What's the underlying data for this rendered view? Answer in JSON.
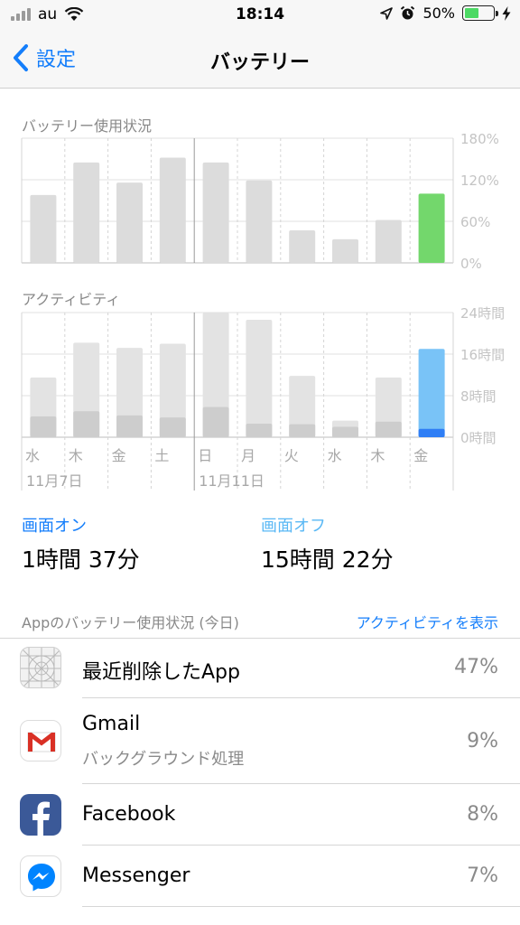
{
  "status_bar": {
    "carrier": "au",
    "time": "18:14",
    "battery_percent": "50%",
    "battery_level": 0.5
  },
  "nav": {
    "back_label": "設定",
    "title": "バッテリー"
  },
  "battery_chart": {
    "label": "バッテリー使用状況",
    "ticks": [
      "180%",
      "120%",
      "60%",
      "0%"
    ]
  },
  "activity_chart": {
    "label": "アクティビティ",
    "ticks": [
      "24時間",
      "16時間",
      "8時間",
      "0時間"
    ]
  },
  "days": [
    "水",
    "木",
    "金",
    "土",
    "日",
    "月",
    "火",
    "水",
    "木",
    "金"
  ],
  "dates": [
    "11月7日",
    "11月11日"
  ],
  "chart_data": [
    {
      "type": "bar",
      "title": "バッテリー使用状況",
      "categories": [
        "水",
        "木",
        "金",
        "土",
        "日",
        "月",
        "火",
        "水",
        "木",
        "金"
      ],
      "values": [
        98,
        145,
        116,
        152,
        145,
        119,
        47,
        34,
        62,
        100
      ],
      "unit": "%",
      "ylim": [
        0,
        180
      ],
      "colors": {
        "default": "#dcdcdc",
        "today": "#73d76c"
      },
      "grid": true
    },
    {
      "type": "bar",
      "title": "アクティビティ",
      "categories": [
        "水",
        "木",
        "金",
        "土",
        "日",
        "月",
        "火",
        "水",
        "木",
        "金"
      ],
      "series": [
        {
          "name": "画面オン",
          "values": [
            4,
            5,
            4.2,
            3.8,
            5.8,
            2.6,
            2.5,
            2,
            3,
            1.6
          ]
        },
        {
          "name": "画面オフ",
          "values": [
            7.5,
            13.2,
            13,
            14.2,
            18.2,
            20,
            9.3,
            1.2,
            8.5,
            15.4
          ]
        }
      ],
      "unit": "時間",
      "ylim": [
        0,
        24
      ],
      "colors": {
        "default_on": "#cdcdcd",
        "default_off": "#e3e3e3",
        "today_on": "#2f7ef5",
        "today_off": "#79c3f7"
      },
      "grid": true
    }
  ],
  "summary": {
    "screen_on_label": "画面オン",
    "screen_on_value": "1時間 37分",
    "screen_off_label": "画面オフ",
    "screen_off_value": "15時間 22分",
    "on_color": "#147efb",
    "off_color": "#5ab8f5"
  },
  "apps_header": {
    "title": "Appのバッテリー使用状況 (今日)",
    "link": "アクティビティを表示"
  },
  "apps": [
    {
      "name": "最近削除したApp",
      "subtitle": "",
      "percent": "47%",
      "icon": "deleted-app-icon"
    },
    {
      "name": "Gmail",
      "subtitle": "バックグラウンド処理",
      "percent": "9%",
      "icon": "gmail-icon"
    },
    {
      "name": "Facebook",
      "subtitle": "",
      "percent": "8%",
      "icon": "facebook-icon"
    },
    {
      "name": "Messenger",
      "subtitle": "",
      "percent": "7%",
      "icon": "messenger-icon"
    }
  ]
}
